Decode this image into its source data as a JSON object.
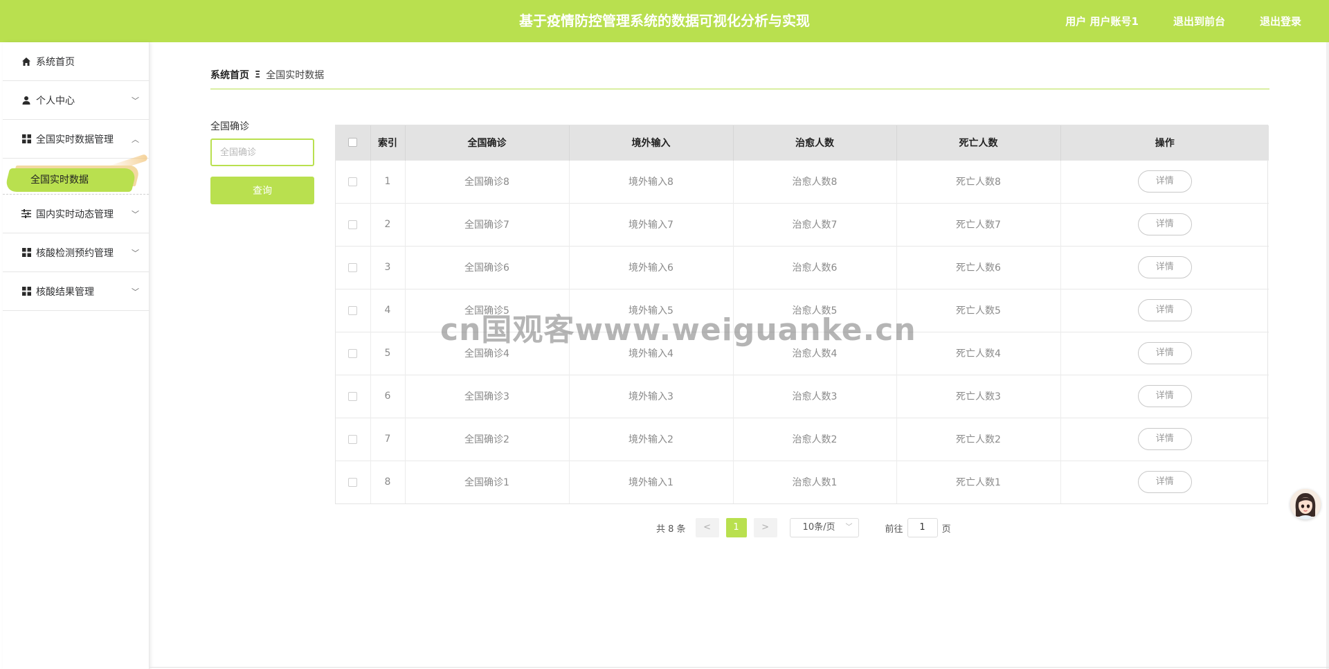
{
  "header": {
    "title": "基于疫情防控管理系统的数据可视化分析与实现",
    "user_label": "用户 用户账号1",
    "to_front_label": "退出到前台",
    "logout_label": "退出登录",
    "accent_color": "#b9e04f"
  },
  "sidebar": {
    "items": [
      {
        "label": "系统首页",
        "icon": "home-icon"
      },
      {
        "label": "个人中心",
        "icon": "user-icon",
        "chevron": "down"
      },
      {
        "label": "全国实时数据管理",
        "icon": "grid-icon",
        "chevron": "up"
      },
      {
        "label": "国内实时动态管理",
        "icon": "sliders-icon",
        "chevron": "down"
      },
      {
        "label": "核酸检测预约管理",
        "icon": "grid-icon",
        "chevron": "down"
      },
      {
        "label": "核酸结果管理",
        "icon": "grid-icon",
        "chevron": "down"
      }
    ],
    "active_sub": "全国实时数据"
  },
  "breadcrumb": {
    "home": "系统首页",
    "separator": "Ξ",
    "current": "全国实时数据"
  },
  "search": {
    "label": "全国确诊",
    "placeholder": "全国确诊",
    "button": "查询"
  },
  "table": {
    "headers": [
      "索引",
      "全国确诊",
      "境外输入",
      "治愈人数",
      "死亡人数",
      "操作"
    ],
    "rows": [
      {
        "index": "1",
        "confirmed": "全国确诊8",
        "imported": "境外输入8",
        "cured": "治愈人数8",
        "dead": "死亡人数8",
        "action": "详情"
      },
      {
        "index": "2",
        "confirmed": "全国确诊7",
        "imported": "境外输入7",
        "cured": "治愈人数7",
        "dead": "死亡人数7",
        "action": "详情"
      },
      {
        "index": "3",
        "confirmed": "全国确诊6",
        "imported": "境外输入6",
        "cured": "治愈人数6",
        "dead": "死亡人数6",
        "action": "详情"
      },
      {
        "index": "4",
        "confirmed": "全国确诊5",
        "imported": "境外输入5",
        "cured": "治愈人数5",
        "dead": "死亡人数5",
        "action": "详情"
      },
      {
        "index": "5",
        "confirmed": "全国确诊4",
        "imported": "境外输入4",
        "cured": "治愈人数4",
        "dead": "死亡人数4",
        "action": "详情"
      },
      {
        "index": "6",
        "confirmed": "全国确诊3",
        "imported": "境外输入3",
        "cured": "治愈人数3",
        "dead": "死亡人数3",
        "action": "详情"
      },
      {
        "index": "7",
        "confirmed": "全国确诊2",
        "imported": "境外输入2",
        "cured": "治愈人数2",
        "dead": "死亡人数2",
        "action": "详情"
      },
      {
        "index": "8",
        "confirmed": "全国确诊1",
        "imported": "境外输入1",
        "cured": "治愈人数1",
        "dead": "死亡人数1",
        "action": "详情"
      }
    ]
  },
  "pagination": {
    "total": "共 8 条",
    "prev": "<",
    "page": "1",
    "next": ">",
    "page_size": "10条/页",
    "goto_prefix": "前往",
    "goto_value": "1",
    "goto_suffix": "页"
  },
  "watermark": "cn国观客www.weiguanke.cn"
}
